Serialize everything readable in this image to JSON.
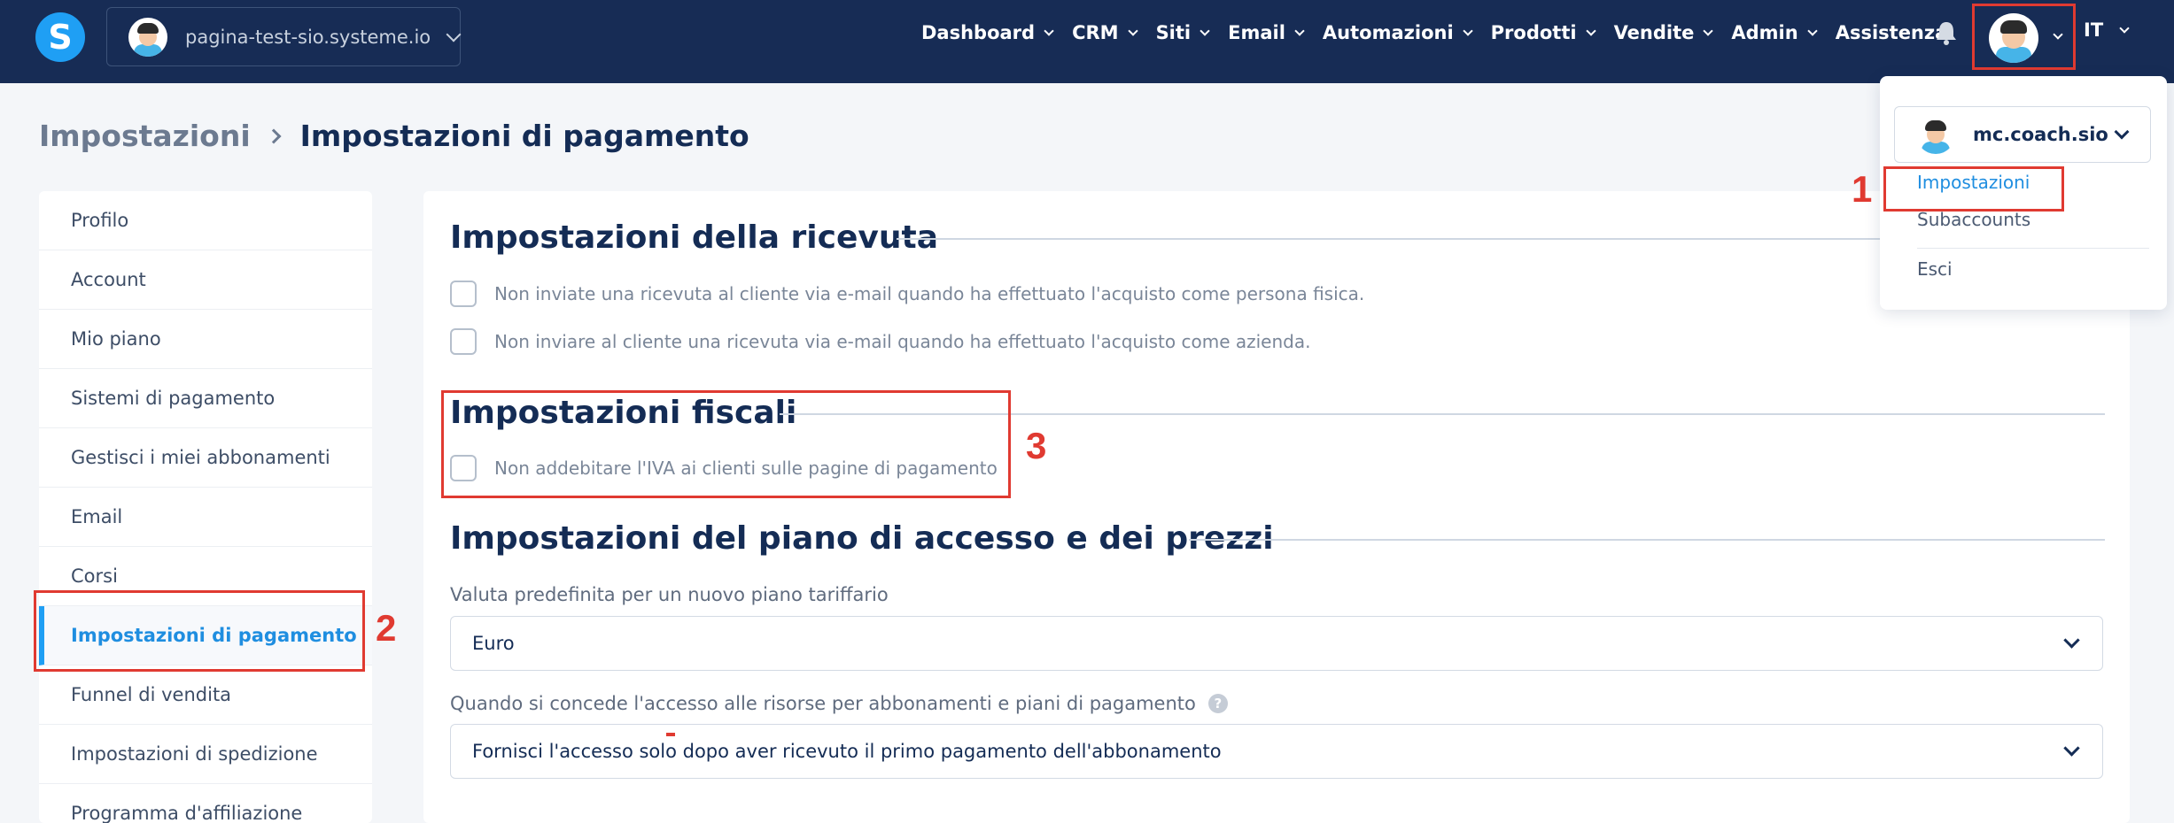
{
  "header": {
    "logo_letter": "S",
    "site": "pagina-test-sio.systeme.io",
    "nav": [
      {
        "label": "Dashboard"
      },
      {
        "label": "CRM"
      },
      {
        "label": "Siti"
      },
      {
        "label": "Email"
      },
      {
        "label": "Automazioni"
      },
      {
        "label": "Prodotti"
      },
      {
        "label": "Vendite"
      },
      {
        "label": "Admin"
      },
      {
        "label": "Assistenza"
      }
    ],
    "language": "IT"
  },
  "breadcrumb": {
    "parent": "Impostazioni",
    "current": "Impostazioni di pagamento"
  },
  "sidebar": {
    "items": [
      {
        "label": "Profilo"
      },
      {
        "label": "Account"
      },
      {
        "label": "Mio piano"
      },
      {
        "label": "Sistemi di pagamento"
      },
      {
        "label": "Gestisci i miei abbonamenti"
      },
      {
        "label": "Email"
      },
      {
        "label": "Corsi"
      },
      {
        "label": "Impostazioni di pagamento"
      },
      {
        "label": "Funnel di vendita"
      },
      {
        "label": "Impostazioni di spedizione"
      },
      {
        "label": "Programma d'affiliazione"
      }
    ],
    "active_index": 7
  },
  "receipt": {
    "title": "Impostazioni della ricevuta",
    "options": [
      "Non inviate una ricevuta al cliente via e-mail quando ha effettuato l'acquisto come persona fisica.",
      "Non inviare al cliente una ricevuta via e-mail quando ha effettuato l'acquisto come azienda."
    ]
  },
  "tax": {
    "title": "Impostazioni fiscali",
    "option": "Non addebitare l'IVA ai clienti sulle pagine di pagamento"
  },
  "pricing": {
    "title": "Impostazioni del piano di accesso e dei prezzi",
    "currency_label": "Valuta predefinita per un nuovo piano tariffario",
    "currency_value": "Euro",
    "access_label": "Quando si concede l'accesso alle risorse per abbonamenti e piani di pagamento",
    "help_glyph": "?",
    "access_value": "Fornisci l'accesso solo dopo aver ricevuto il primo pagamento dell'abbonamento"
  },
  "user_menu": {
    "account": "mc.coach.sio",
    "items": [
      {
        "label": "Impostazioni"
      },
      {
        "label": "Subaccounts"
      },
      {
        "label": "Esci"
      }
    ]
  },
  "annotations": {
    "n1": "1",
    "n2": "2",
    "n3": "3"
  },
  "colors": {
    "topbar": "#172c55",
    "accent": "#1f9ff4",
    "annotation": "#e03a31"
  }
}
